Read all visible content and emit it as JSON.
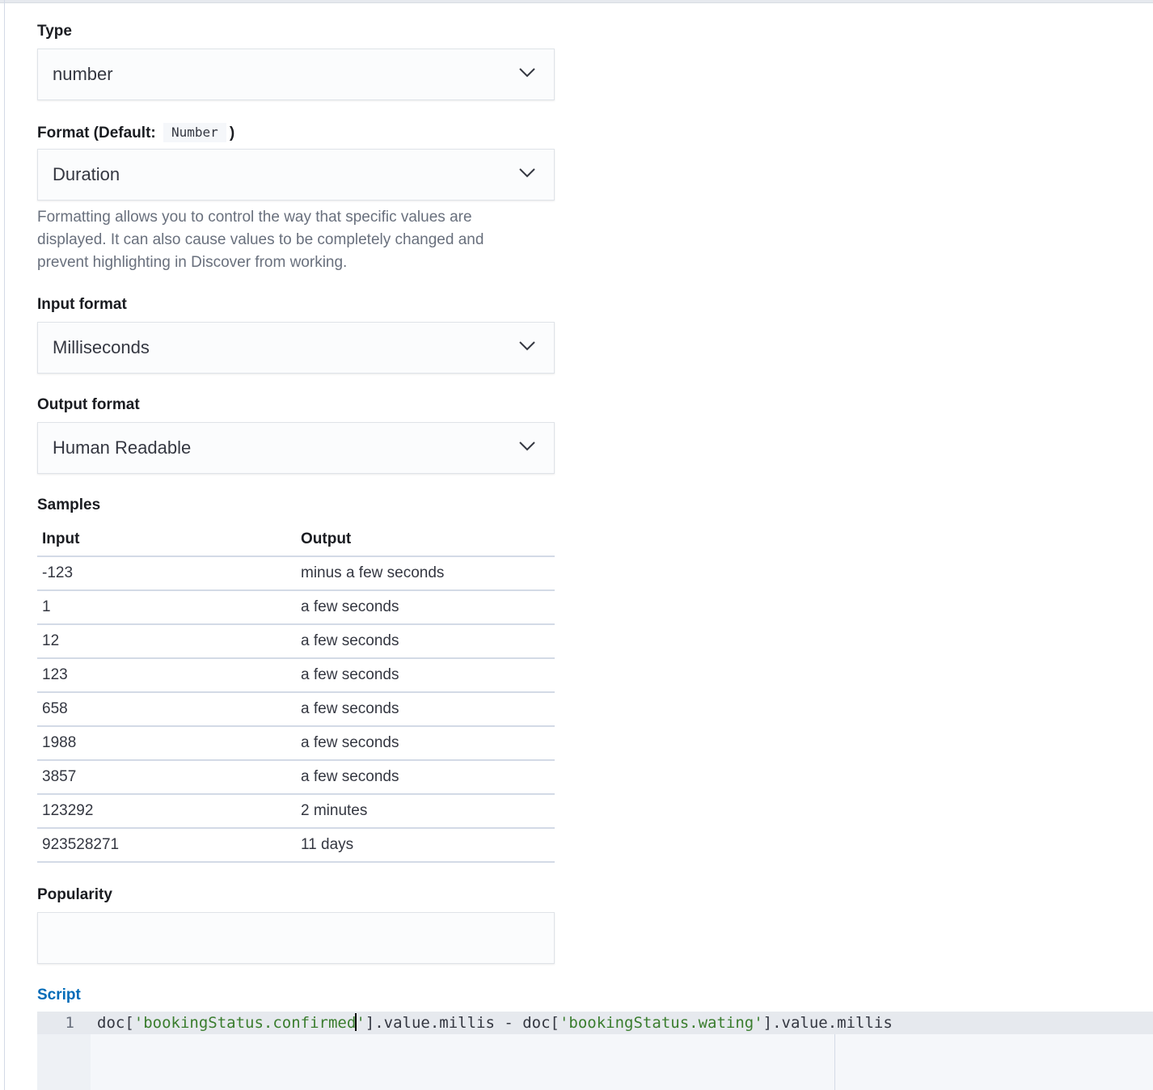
{
  "type_field": {
    "label": "Type",
    "value": "number"
  },
  "format_field": {
    "label_prefix": "Format (Default:",
    "default_value": "Number",
    "label_suffix": ")",
    "value": "Duration",
    "help_text": "Formatting allows you to control the way that specific values are displayed. It can also cause values to be completely changed and prevent highlighting in Discover from working."
  },
  "input_format_field": {
    "label": "Input format",
    "value": "Milliseconds"
  },
  "output_format_field": {
    "label": "Output format",
    "value": "Human Readable"
  },
  "samples": {
    "label": "Samples",
    "columns": [
      "Input",
      "Output"
    ],
    "rows": [
      [
        "-123",
        "minus a few seconds"
      ],
      [
        "1",
        "a few seconds"
      ],
      [
        "12",
        "a few seconds"
      ],
      [
        "123",
        "a few seconds"
      ],
      [
        "658",
        "a few seconds"
      ],
      [
        "1988",
        "a few seconds"
      ],
      [
        "3857",
        "a few seconds"
      ],
      [
        "123292",
        "2 minutes"
      ],
      [
        "923528271",
        "11 days"
      ]
    ]
  },
  "popularity_field": {
    "label": "Popularity",
    "value": ""
  },
  "script_field": {
    "label": "Script",
    "line_number": "1",
    "tokens": {
      "t1": "doc[",
      "t2": "'bookingStatus.confirmed",
      "t3": "'",
      "t4": "].value.millis - doc[",
      "t5": "'bookingStatus.wating'",
      "t6": "].value.millis"
    }
  },
  "icons": {
    "select_arrow": "chevron-down-icon"
  }
}
